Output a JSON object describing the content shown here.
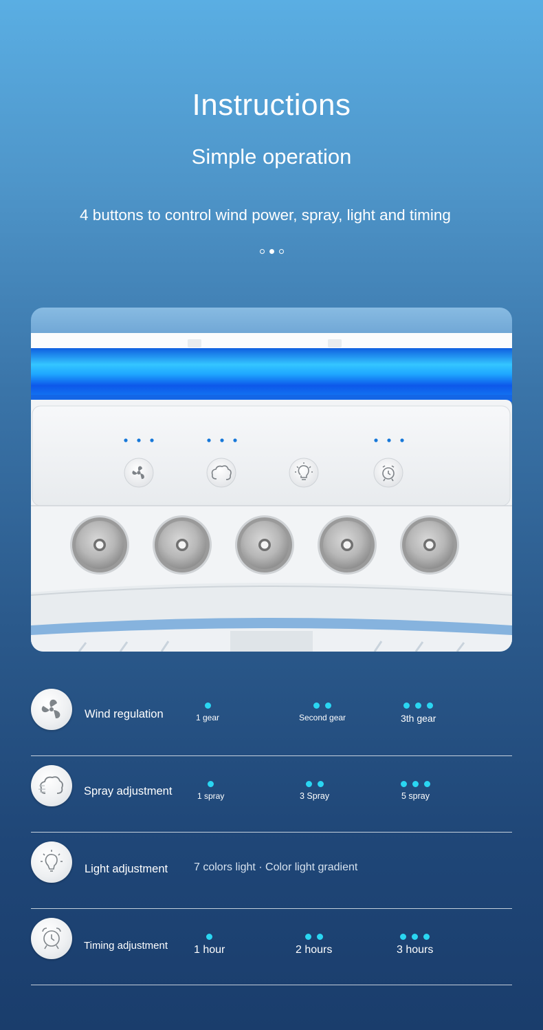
{
  "header": {
    "title": "Instructions",
    "subtitle": "Simple operation",
    "tagline": "4 buttons to control wind power, spray, light and timing",
    "pager_active_index": 1,
    "pager_count": 3
  },
  "colors": {
    "indicator": "#2ad6f2",
    "bg_top": "#5aaee3",
    "bg_bottom": "#1a3d6c",
    "led_blue": "#1a7ff0"
  },
  "features": [
    {
      "label": "Wind regulation",
      "icon": "fan-icon",
      "options": [
        {
          "level": 1,
          "label": "1 gear"
        },
        {
          "level": 2,
          "label": "Second gear"
        },
        {
          "level": 3,
          "label": "3th gear"
        }
      ]
    },
    {
      "label": "Spray adjustment",
      "icon": "spray-cloud-icon",
      "options": [
        {
          "level": 1,
          "label": "1 spray"
        },
        {
          "level": 2,
          "label": "3 Spray"
        },
        {
          "level": 3,
          "label": "5 spray"
        }
      ]
    },
    {
      "label": "Light adjustment",
      "icon": "bulb-icon",
      "description": "7 colors light · Color light gradient"
    },
    {
      "label": "Timing adjustment",
      "icon": "alarm-clock-icon",
      "options": [
        {
          "level": 1,
          "label": "1 hour"
        },
        {
          "level": 2,
          "label": "2 hours"
        },
        {
          "level": 3,
          "label": "3 hours"
        }
      ]
    }
  ]
}
